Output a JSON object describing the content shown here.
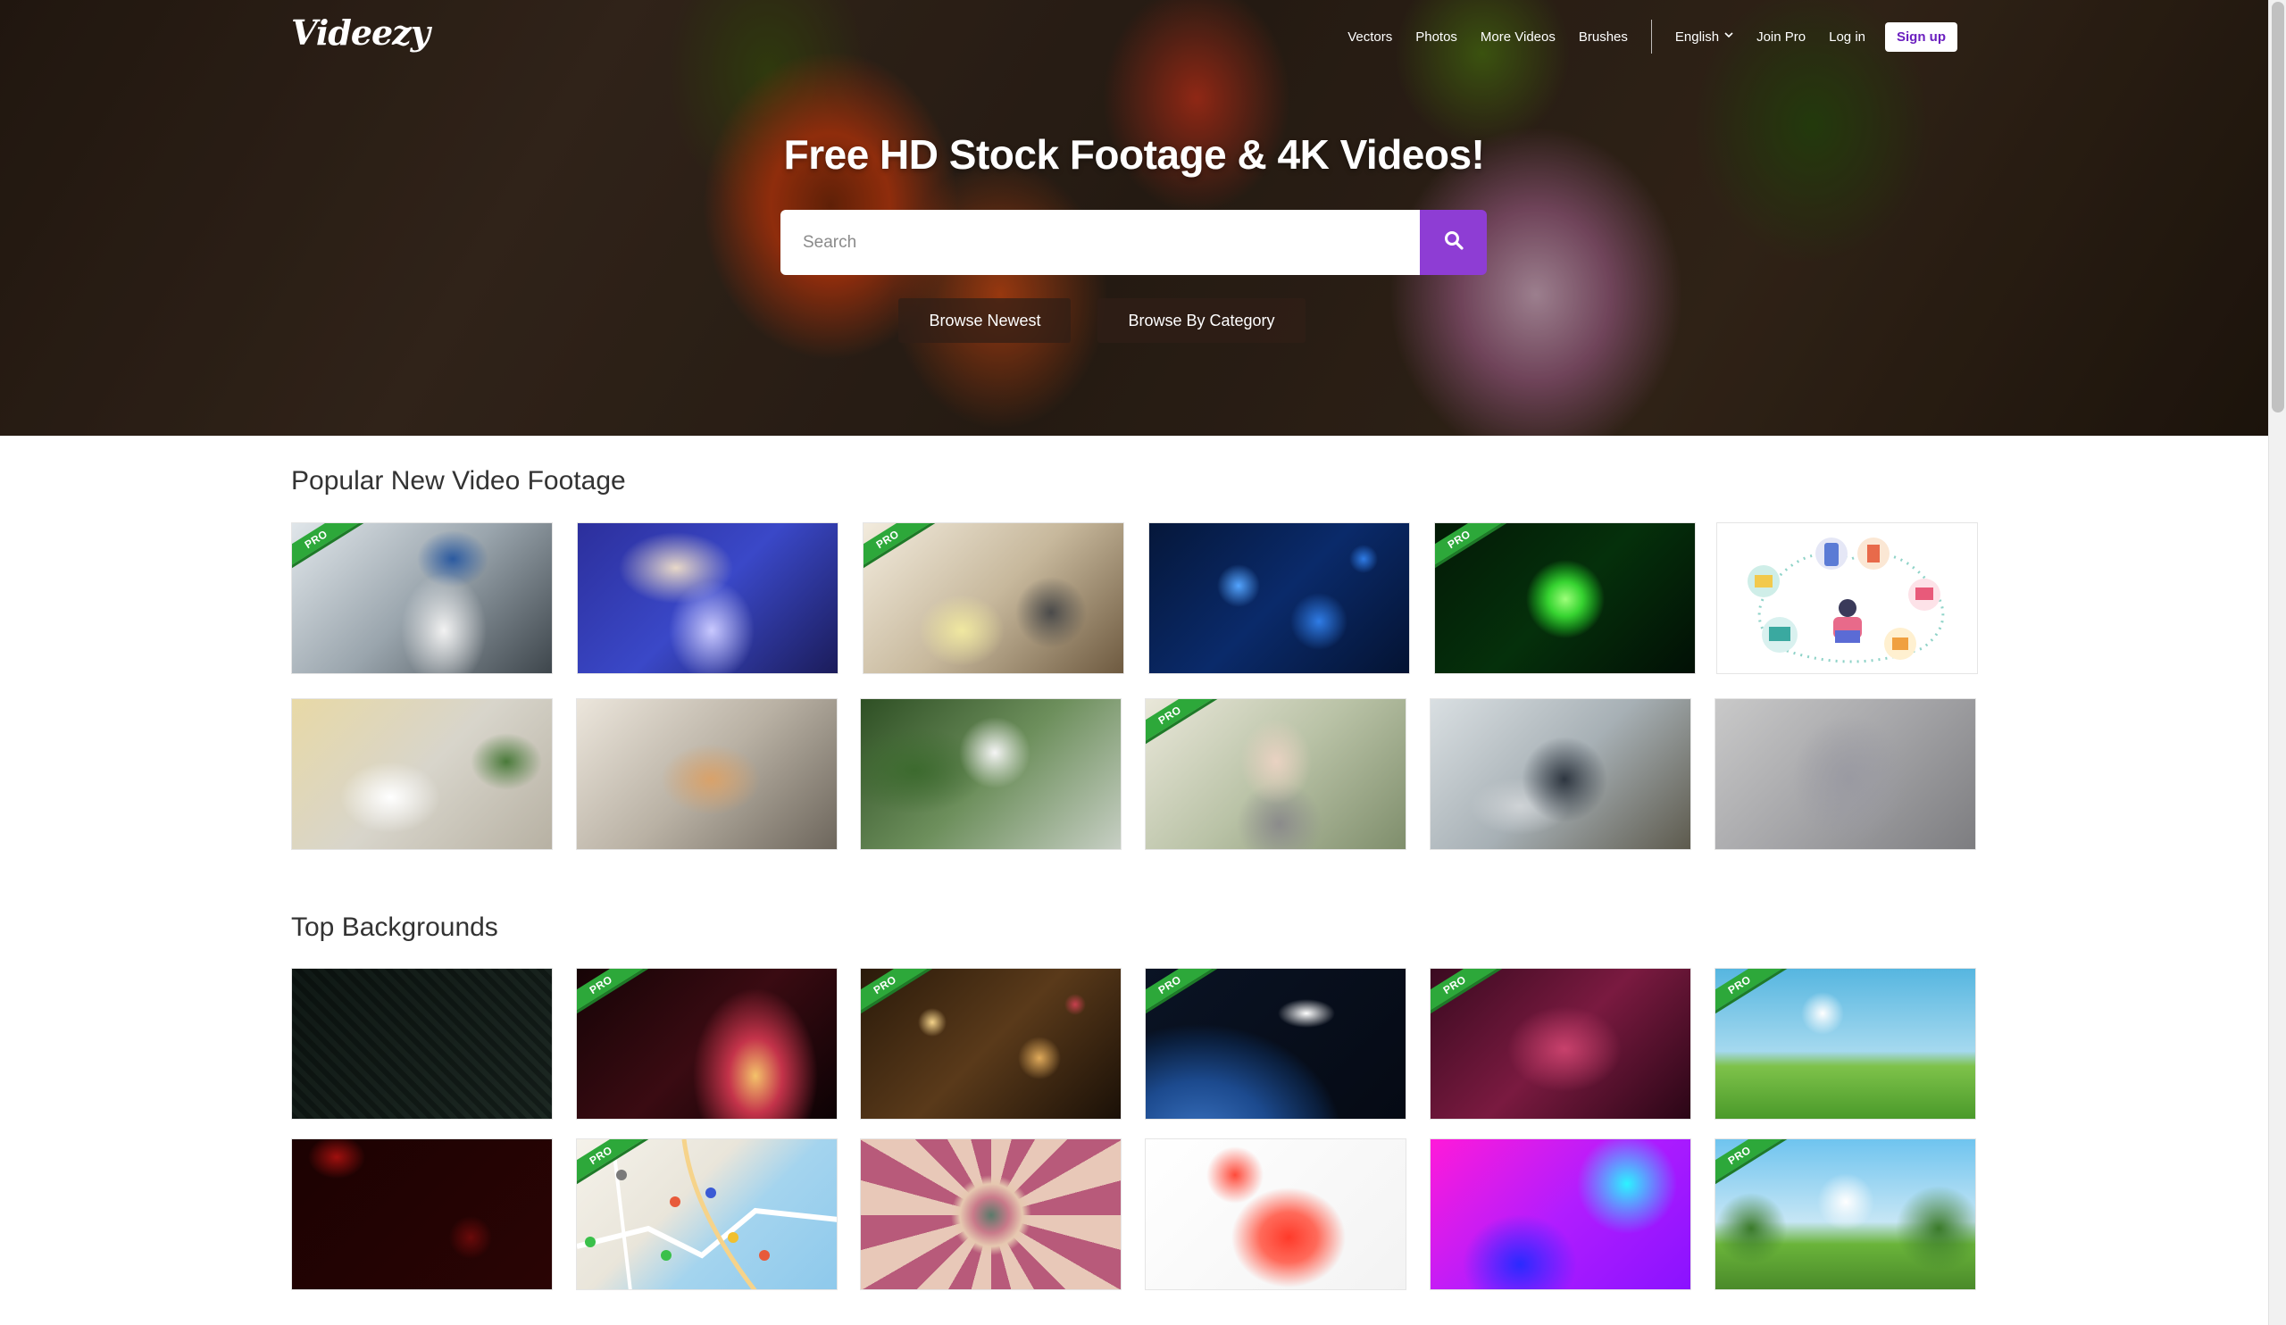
{
  "brand": {
    "logo": "Videezy"
  },
  "nav": {
    "links": [
      "Vectors",
      "Photos",
      "More Videos",
      "Brushes"
    ],
    "language": "English",
    "join_pro": "Join Pro",
    "log_in": "Log in",
    "sign_up": "Sign up"
  },
  "hero": {
    "title": "Free HD Stock Footage & 4K Videos!",
    "search_placeholder": "Search",
    "browse_newest": "Browse Newest",
    "browse_category": "Browse By Category"
  },
  "sections": {
    "popular": {
      "title": "Popular New Video Footage",
      "badge_label": "PRO"
    },
    "backgrounds": {
      "title": "Top Backgrounds",
      "badge_label": "PRO"
    }
  },
  "colors": {
    "accent": "#8e3dd4",
    "signup_text": "#6b1fbf",
    "pro_badge": "#2da83a"
  },
  "icons": {
    "search": "search-icon",
    "language": "chevron-down-icon"
  }
}
